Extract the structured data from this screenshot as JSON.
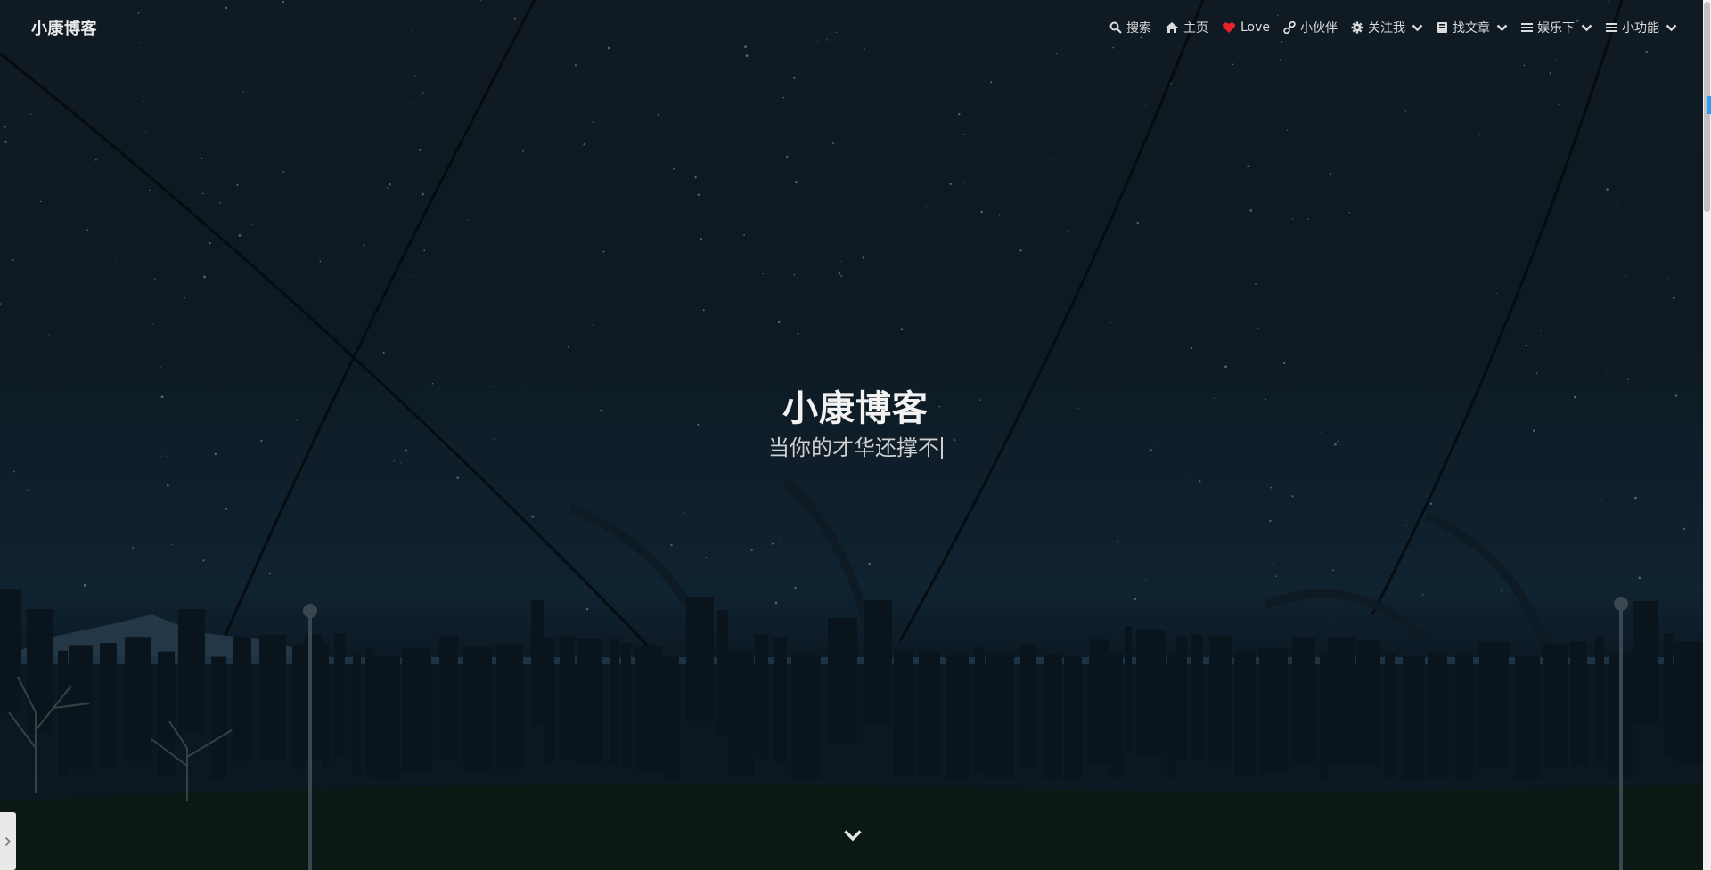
{
  "brand": {
    "title": "小康博客"
  },
  "nav": {
    "items": [
      {
        "label": "搜索",
        "icon": "search-icon",
        "dropdown": false
      },
      {
        "label": "主页",
        "icon": "home-icon",
        "dropdown": false
      },
      {
        "label": "Love",
        "icon": "heart-icon",
        "dropdown": false
      },
      {
        "label": "小伙伴",
        "icon": "link-icon",
        "dropdown": false
      },
      {
        "label": "关注我",
        "icon": "gear-icon",
        "dropdown": true
      },
      {
        "label": "找文章",
        "icon": "book-icon",
        "dropdown": true
      },
      {
        "label": "娱乐下",
        "icon": "menu-icon",
        "dropdown": true
      },
      {
        "label": "小功能",
        "icon": "menu-icon",
        "dropdown": true
      }
    ]
  },
  "hero": {
    "title": "小康博客",
    "subtitle": "当你的才华还撑不"
  },
  "colors": {
    "heart": "#e8232a",
    "text": "#dcdcdc",
    "background": "#0f1a22"
  },
  "icons": {
    "scroll_down": "chevron-down-icon",
    "side_toggle": "chevron-right-icon"
  }
}
